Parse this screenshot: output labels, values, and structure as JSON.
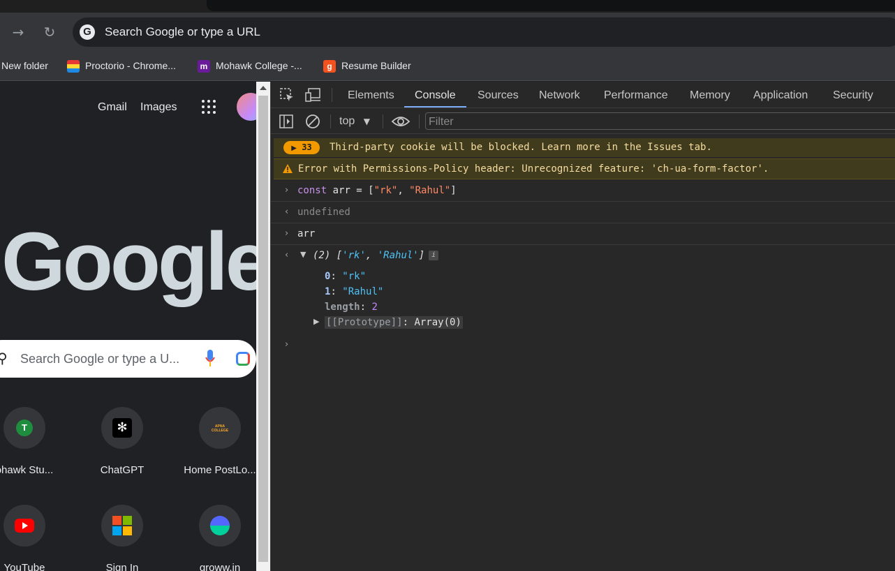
{
  "browser": {
    "omnibox_placeholder": "Search Google or type a URL",
    "bookmarks": [
      {
        "label": "New folder",
        "icon": "folder-icon"
      },
      {
        "label": "Proctorio - Chrome...",
        "icon": "proctorio-icon"
      },
      {
        "label": "Mohawk College -...",
        "icon": "mohawk-icon",
        "icon_text": "m",
        "color": "#6a1b9a"
      },
      {
        "label": "Resume Builder",
        "icon": "resume-builder-icon",
        "icon_text": "g",
        "color": "#f4511e"
      }
    ]
  },
  "google_page": {
    "links": {
      "gmail": "Gmail",
      "images": "Images"
    },
    "logo": "Google",
    "search_placeholder": "Search Google or type a U...",
    "shortcuts": [
      {
        "label": "ohawk Stu...",
        "icon_text": "T",
        "icon": "letter-t-icon",
        "color": "#1e8e3e"
      },
      {
        "label": "ChatGPT",
        "icon": "chatgpt-icon"
      },
      {
        "label": "Home PostLo...",
        "icon": "apna-college-icon",
        "icon_text": "APNA COLLEGE"
      },
      {
        "label": "YouTube",
        "icon": "youtube-icon",
        "color": "#ff0000"
      },
      {
        "label": "Sign In",
        "icon": "microsoft-icon"
      },
      {
        "label": "groww.in",
        "icon": "groww-icon"
      }
    ]
  },
  "devtools": {
    "tabs": [
      "Elements",
      "Console",
      "Sources",
      "Network",
      "Performance",
      "Memory",
      "Application",
      "Security"
    ],
    "active_tab": "Console",
    "context": "top",
    "filter_placeholder": "Filter",
    "issues_count": "33",
    "issues_message": "Third-party cookie will be blocked. Learn more in the Issues tab.",
    "warning_message": "Error with Permissions-Policy header: Unrecognized feature: 'ch-ua-form-factor'.",
    "console": {
      "input1": {
        "keyword": "const",
        "rest1": " arr = [",
        "s1": "\"rk\"",
        "comma": ", ",
        "s2": "\"Rahul\"",
        "close": "]"
      },
      "output1": "undefined",
      "input2": "arr",
      "output2": {
        "preview_count": "(2) [",
        "p1": "'rk'",
        "p2": "'Rahul'",
        "preview_close": "]",
        "info": "i",
        "entries": [
          {
            "key": "0",
            "value": "\"rk\""
          },
          {
            "key": "1",
            "value": "\"Rahul\""
          }
        ],
        "length_key": "length",
        "length_value": "2",
        "prototype_key": "[[Prototype]]",
        "prototype_value": "Array(0)"
      }
    }
  }
}
